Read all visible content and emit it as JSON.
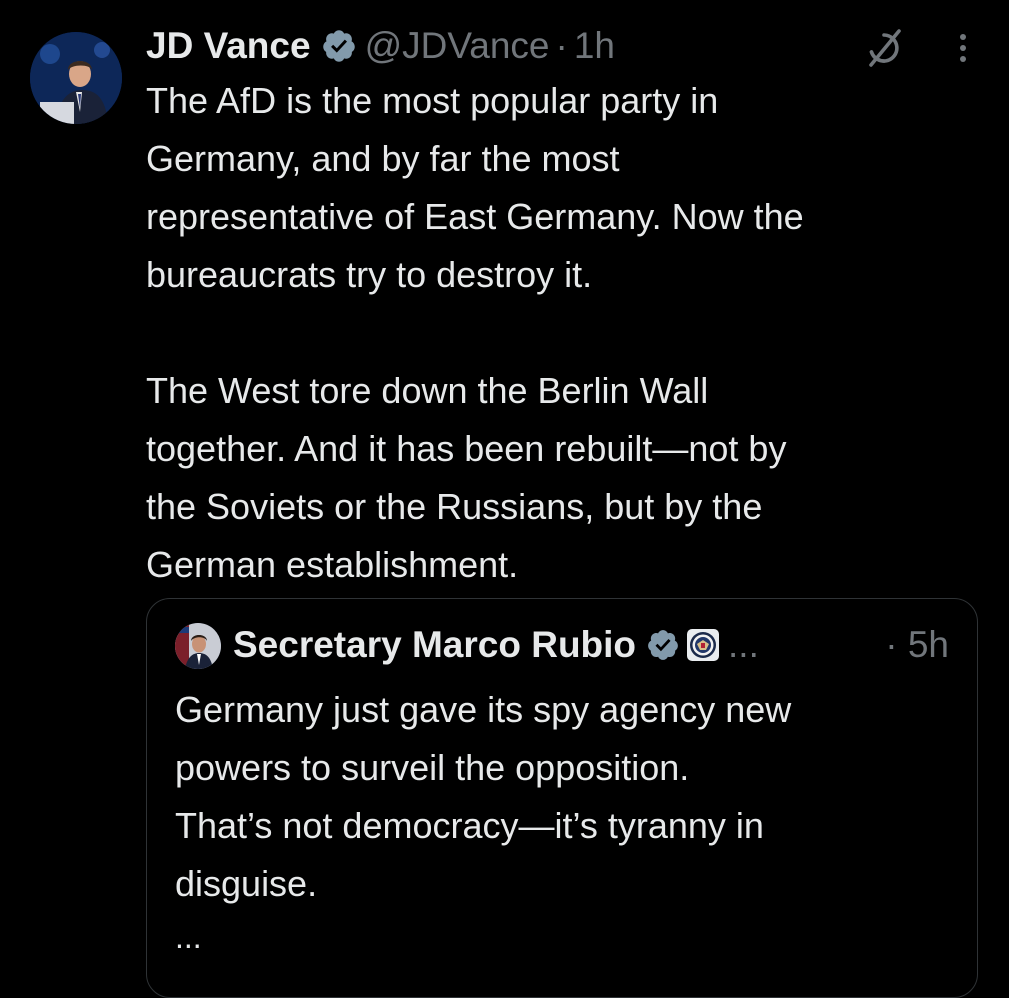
{
  "tweet": {
    "display_name": "JD Vance",
    "handle": "@JDVance",
    "separator": "·",
    "time": "1h",
    "body_paragraphs": [
      "The AfD is the most popular party in\nGermany, and by far the most\nrepresentative of East Germany. Now the\nbureaucrats try to destroy it.",
      "The West tore down the Berlin Wall\ntogether. And it has been rebuilt—not by\nthe Soviets or the Russians, but by the\nGerman establishment."
    ],
    "icons": {
      "avatar": "profile-photo",
      "verified": "verified-badge-icon",
      "grok": "grok-icon",
      "more": "more-options-icon"
    }
  },
  "quoted_tweet": {
    "display_name": "Secretary Marco Rubio",
    "ellipsis": "...",
    "separator": "·",
    "time": "5h",
    "body": "Germany just gave its spy agency new\npowers to surveil the opposition.\nThat’s not democracy—it’s tyranny in\ndisguise.",
    "more": "...",
    "icons": {
      "avatar": "profile-photo",
      "verified": "verified-badge-icon",
      "affiliation": "state-department-seal-icon"
    }
  },
  "colors": {
    "background": "#000000",
    "text": "#e7e9ea",
    "secondary_text": "#71767b",
    "border": "#2f3336",
    "verified_badge": "#829aab"
  }
}
